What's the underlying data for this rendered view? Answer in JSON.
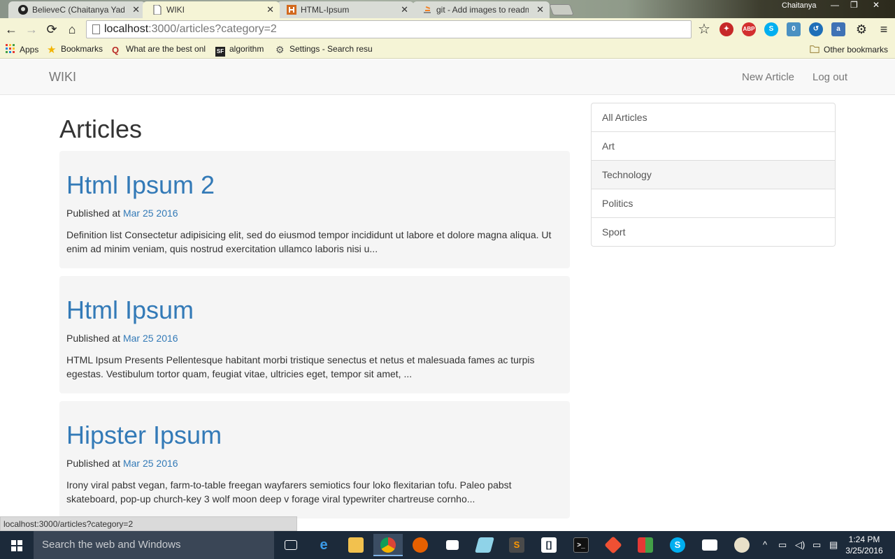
{
  "browser": {
    "tabs": [
      {
        "title": "BelieveC (Chaitanya Yadav",
        "icon": "github-icon",
        "active": false
      },
      {
        "title": "WIKI",
        "icon": "page-icon",
        "active": true
      },
      {
        "title": "HTML-Ipsum",
        "icon": "html-ipsum-icon",
        "active": false
      },
      {
        "title": "git - Add images to readme",
        "icon": "stackoverflow-icon",
        "active": false
      }
    ],
    "close_glyph": "✕",
    "user_name": "Chaitanya",
    "url_host": "localhost",
    "url_path": ":3000/articles?category=2",
    "bookmarks": [
      {
        "label": "Apps",
        "icon": "apps-grid-icon"
      },
      {
        "label": "Bookmarks",
        "icon": "star-icon"
      },
      {
        "label": "What are the best onl",
        "icon": "quora-icon"
      },
      {
        "label": "algorithm",
        "icon": "sf-icon"
      },
      {
        "label": "Settings - Search resu",
        "icon": "gear-icon"
      }
    ],
    "other_bookmarks": "Other bookmarks",
    "status_url": "localhost:3000/articles?category=2"
  },
  "page": {
    "brand": "WIKI",
    "nav": {
      "new_article": "New Article",
      "log_out": "Log out"
    },
    "title": "Articles",
    "published_label": "Published at",
    "articles": [
      {
        "title": "Html Ipsum 2",
        "date": "Mar 25 2016",
        "excerpt": "Definition list Consectetur adipisicing elit, sed do eiusmod tempor incididunt ut labore et dolore magna aliqua. Ut enim ad minim veniam, quis nostrud exercitation ullamco laboris nisi u..."
      },
      {
        "title": "Html Ipsum",
        "date": "Mar 25 2016",
        "excerpt": "HTML Ipsum Presents Pellentesque habitant morbi tristique senectus et netus et malesuada fames ac turpis egestas. Vestibulum tortor quam, feugiat vitae, ultricies eget, tempor sit amet, ..."
      },
      {
        "title": "Hipster Ipsum",
        "date": "Mar 25 2016",
        "excerpt": "Irony viral pabst vegan, farm-to-table freegan wayfarers semiotics four loko flexitarian tofu. Paleo pabst skateboard, pop-up church-key 3 wolf moon deep v forage viral typewriter chartreuse cornho..."
      }
    ],
    "categories": [
      {
        "label": "All Articles",
        "active": false
      },
      {
        "label": "Art",
        "active": false
      },
      {
        "label": "Technology",
        "active": true
      },
      {
        "label": "Politics",
        "active": false
      },
      {
        "label": "Sport",
        "active": false
      }
    ]
  },
  "taskbar": {
    "search_placeholder": "Search the web and Windows",
    "time": "1:24 PM",
    "date": "3/25/2016"
  },
  "colors": {
    "link": "#337ab7",
    "taskbar": "#1c2a3a"
  }
}
